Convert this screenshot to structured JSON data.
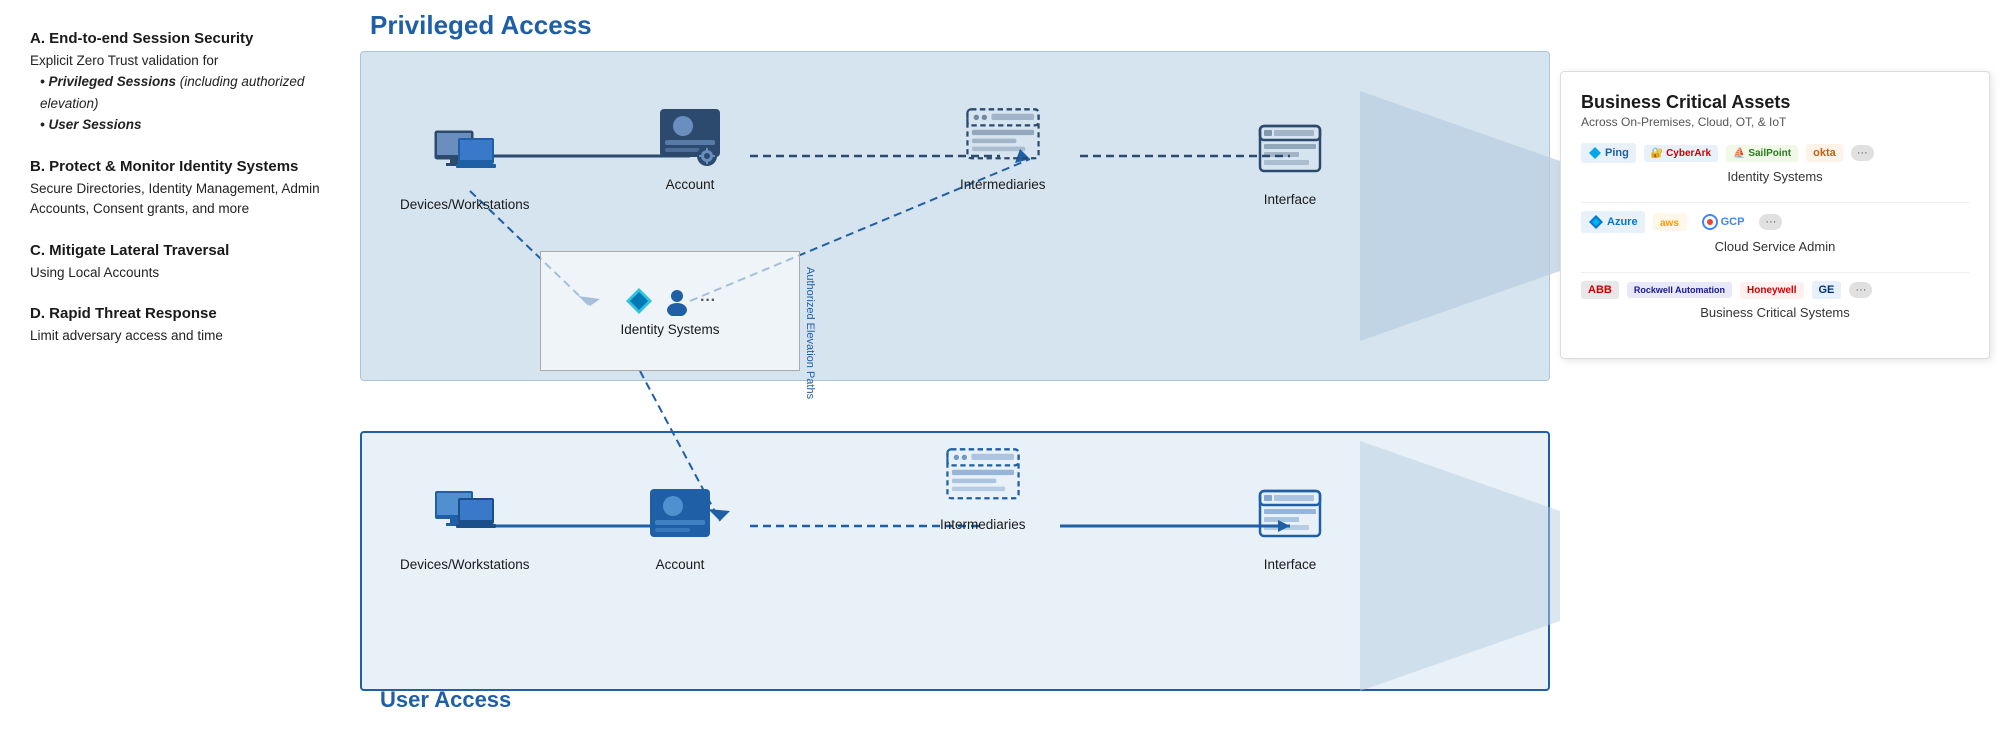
{
  "left_panel": {
    "sections": [
      {
        "id": "A",
        "title": "A. End-to-end Session Security",
        "body": "Explicit Zero Trust validation for",
        "bullets": [
          "Privileged Sessions (including authorized elevation)",
          "User Sessions"
        ]
      },
      {
        "id": "B",
        "title": "B. Protect & Monitor Identity Systems",
        "body": "Secure Directories, Identity Management, Admin Accounts, Consent grants, and more"
      },
      {
        "id": "C",
        "title": "C. Mitigate Lateral Traversal",
        "body": "Using Local Accounts"
      },
      {
        "id": "D",
        "title": "D. Rapid Threat Response",
        "body": "Limit adversary access and time"
      }
    ]
  },
  "diagram": {
    "privileged_title": "Privileged Access",
    "user_title": "User Access",
    "nodes": {
      "priv_devices": "Devices/Workstations",
      "priv_account": "Account",
      "priv_intermediaries": "Intermediaries",
      "priv_interface": "Interface",
      "identity_systems": "Identity Systems",
      "user_devices": "Devices/Workstations",
      "user_account": "Account",
      "user_intermediaries": "Intermediaries",
      "user_interface": "Interface"
    },
    "arrow_label": "Authorized Elevation Paths"
  },
  "bca": {
    "title": "Business Critical Assets",
    "subtitle": "Across On-Premises, Cloud, OT, & IoT",
    "sections": [
      {
        "label": "Identity Systems",
        "logos": [
          "Ping",
          "CyberArk",
          "SailPoint",
          "okta",
          "..."
        ]
      },
      {
        "label": "Cloud Service Admin",
        "logos": [
          "Azure",
          "aws",
          "Google",
          "..."
        ]
      },
      {
        "label": "Business Critical Systems",
        "logos": [
          "ABB",
          "Rockwell Automation",
          "Honeywell",
          "GE",
          "..."
        ]
      }
    ]
  }
}
